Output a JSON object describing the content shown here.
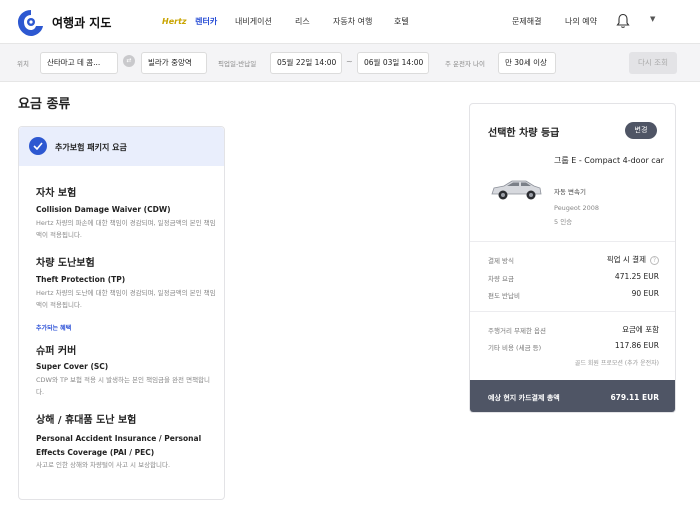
{
  "nav": {
    "brand": "여행과 지도",
    "hertz": "Hertz",
    "rentacar": "렌터카",
    "navigation": "내비게이션",
    "lease": "리스",
    "car_travel": "자동차 여행",
    "hotel": "호텔",
    "help": "문제해결",
    "my_booking": "나의 예약",
    "accent": "#2a4fd6"
  },
  "search": {
    "location_label": "위치",
    "pickup_location": "산타마고 데 콤...",
    "dropoff_location": "빌라가 중앙역",
    "date_label": "픽업일-반납일",
    "pickup_date": "05월 22일 14:00",
    "dropoff_date": "06월 03일 14:00",
    "driver_age_label": "주 운전자 나이",
    "driver_age": "만 30세 이상",
    "research_button": "다시 조회"
  },
  "rate": {
    "section_title": "요금 종류",
    "package_label": "추가보험 패키지 요금",
    "extra_tag": "추가되는 혜택",
    "items": [
      {
        "title": "자차 보험",
        "subtitle": "Collision Damage Waiver (CDW)",
        "desc": "Hertz 차량의 파손에 대한 책임이 경감되며, 일정금액의 본인 책임액이 적용됩니다."
      },
      {
        "title": "차량 도난보험",
        "subtitle": "Theft Protection (TP)",
        "desc": "Hertz 차량의 도난에 대한 책임이 경감되며, 일정금액의 본인 책임액이 적용됩니다."
      },
      {
        "title": "슈퍼 커버",
        "subtitle": "Super Cover (SC)",
        "desc": "CDW와 TP 보험 적용 시 발생하는 본인 책임금을 완전 면책합니다."
      },
      {
        "title": "상해 / 휴대품 도난 보험",
        "subtitle": "Personal Accident Insurance / Personal Effects Coverage (PAI / PEC)",
        "desc": "사고로 인한 상해와 차량털이 사고 시 보상합니다."
      }
    ]
  },
  "summary": {
    "title": "선택한 차량 등급",
    "change_button": "변경",
    "car_name": "그룹 E - Compact 4-door car",
    "transmission": "자동 변속기",
    "model": "Peugeot 2008",
    "seats": "5 인승",
    "payment_method_label": "결제 방식",
    "payment_method_value": "픽업 시 결제",
    "vehicle_fee_label": "차량 요금",
    "vehicle_fee_value": "471.25 EUR",
    "oneway_fee_label": "편도 반납비",
    "oneway_fee_value": "90 EUR",
    "mileage_label": "주행거리 무제한 옵션",
    "mileage_value": "요금에 포함",
    "other_fee_label": "기타 비용 (세금 등)",
    "other_fee_value": "117.86 EUR",
    "promo_note": "골드 회원 프로모션 (추가 운전자)",
    "total_label": "예상 현지 카드결제 총액",
    "total_value": "679.11 EUR"
  }
}
